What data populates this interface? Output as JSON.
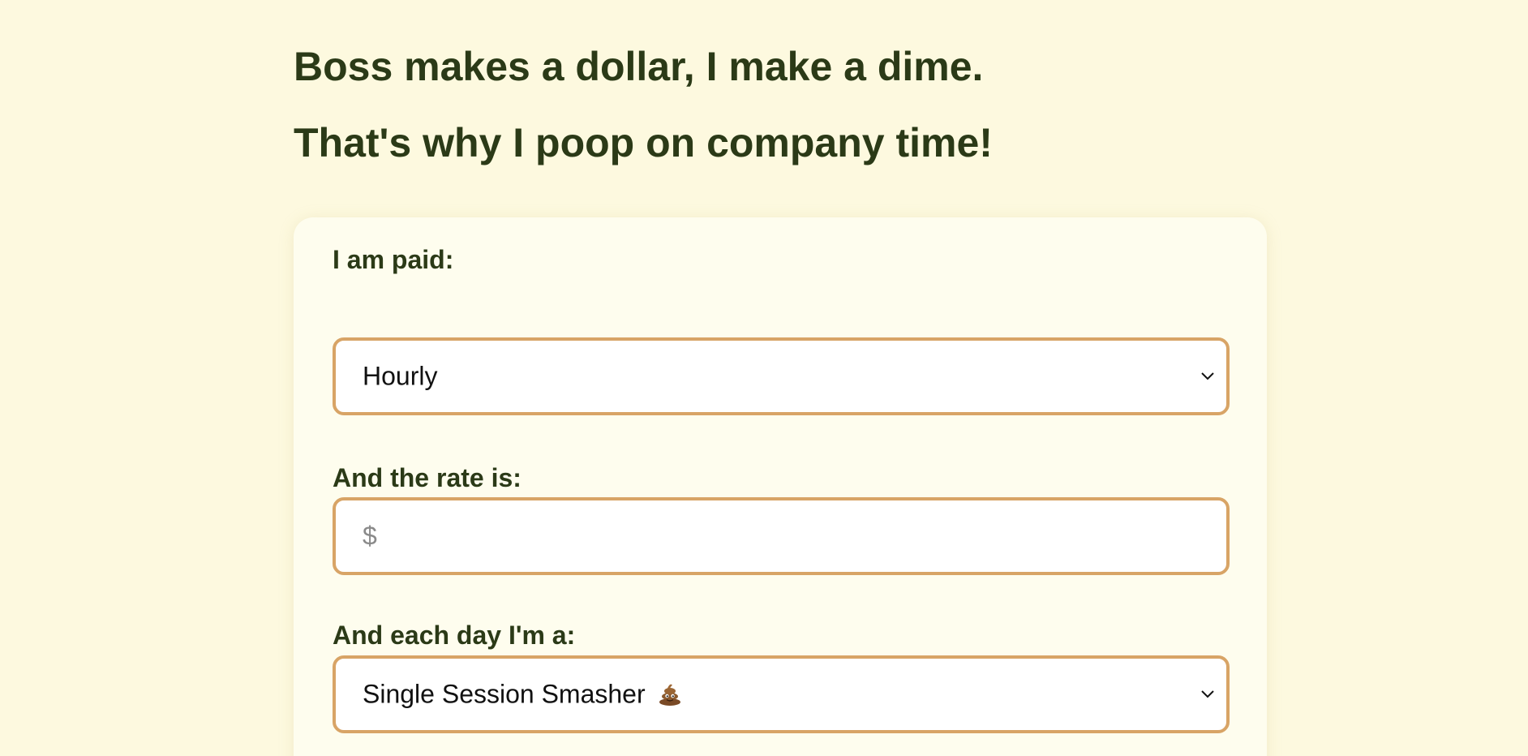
{
  "headings": [
    "Boss makes a dollar, I make a dime.",
    "That's why I poop on company time!"
  ],
  "form": {
    "pay_type": {
      "label": "I am paid:",
      "value": "Hourly"
    },
    "rate": {
      "label": "And the rate is:",
      "placeholder": "$",
      "value": ""
    },
    "frequency": {
      "label": "And each day I'm a:",
      "value": "Single Session Smasher",
      "icon": "poop-emoji-icon"
    }
  },
  "colors": {
    "background": "#fdf9df",
    "card": "#fefdee",
    "text": "#2b3a17",
    "accent_border": "#d8a466"
  }
}
